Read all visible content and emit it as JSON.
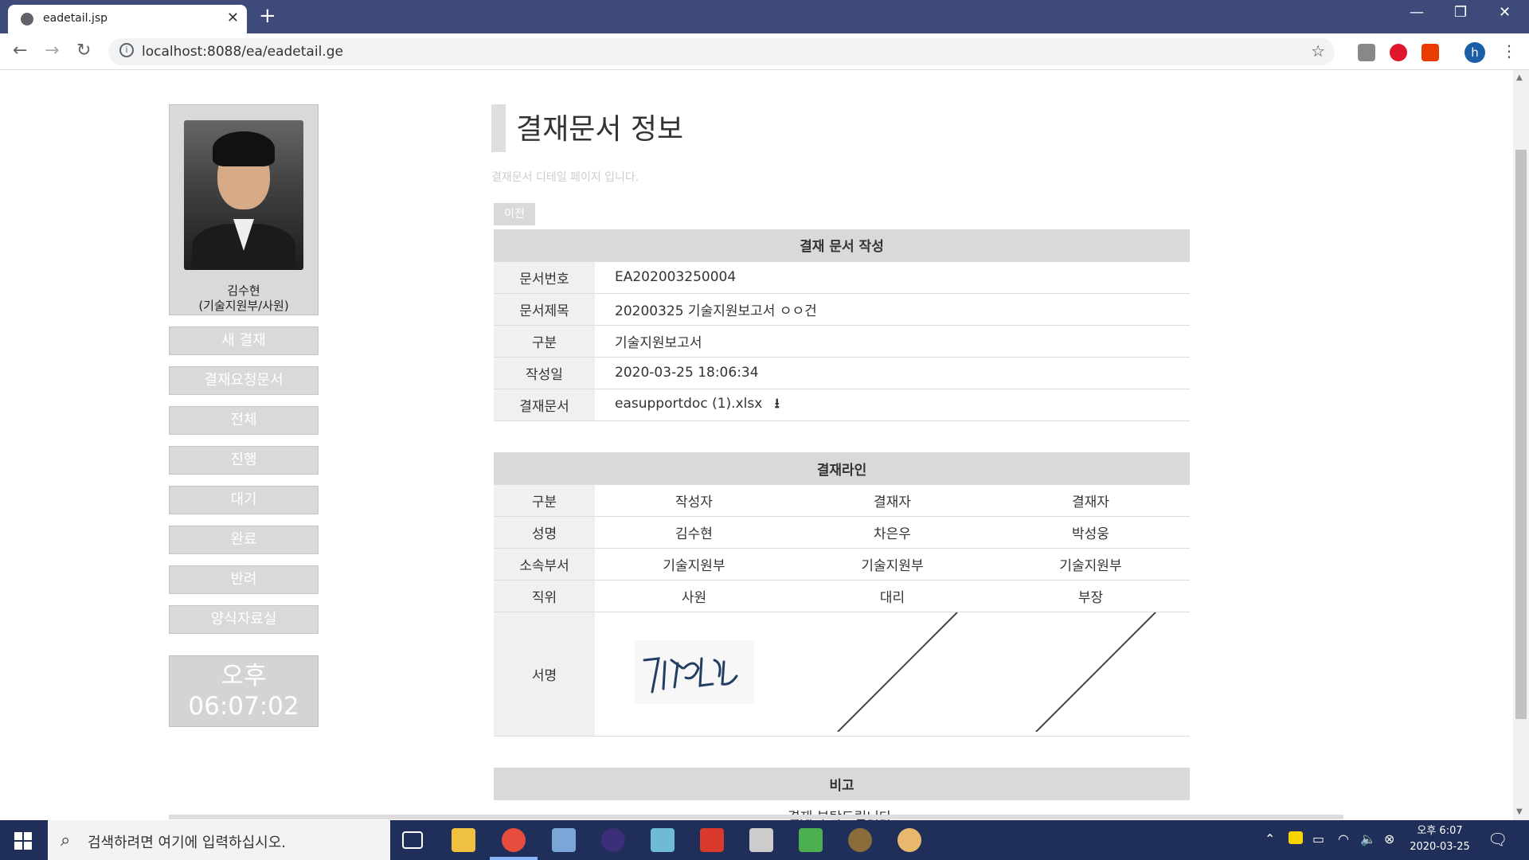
{
  "browser": {
    "tab_title": "eadetail.jsp",
    "url": "localhost:8088/ea/eadetail.ge",
    "avatar_letter": "h"
  },
  "sidebar": {
    "user_name": "김수현",
    "user_dept": "(기술지원부/사원)",
    "menu": [
      "새 결재",
      "결재요청문서",
      "전체",
      "진행",
      "대기",
      "완료",
      "반려",
      "양식자료실"
    ],
    "clock_ampm": "오후",
    "clock_time": "06:07:02"
  },
  "main": {
    "title": "결재문서 정보",
    "subtitle": "결재문서 디테일 페이지 입니다.",
    "prev_label": "이전",
    "section_doc": "결재 문서 작성",
    "doc_fields": [
      {
        "label": "문서번호",
        "value": "EA202003250004"
      },
      {
        "label": "문서제목",
        "value": "20200325 기술지원보고서 ㅇㅇ건"
      },
      {
        "label": "구분",
        "value": "기술지원보고서"
      },
      {
        "label": "작성일",
        "value": "2020-03-25 18:06:34"
      },
      {
        "label": "결재문서",
        "value": "easupportdoc (1).xlsx"
      }
    ],
    "section_line": "결재라인",
    "line_rows": [
      {
        "label": "구분",
        "cells": [
          "작성자",
          "결재자",
          "결재자"
        ]
      },
      {
        "label": "성명",
        "cells": [
          "김수현",
          "차은우",
          "박성웅"
        ]
      },
      {
        "label": "소속부서",
        "cells": [
          "기술지원부",
          "기술지원부",
          "기술지원부"
        ]
      },
      {
        "label": "직위",
        "cells": [
          "사원",
          "대리",
          "부장"
        ]
      }
    ],
    "signature_label": "서명",
    "section_note": "비고",
    "note_text": "결재 부탁드립니다."
  },
  "taskbar": {
    "search_placeholder": "검색하려면 여기에 입력하십시오.",
    "time_ampm_time": "오후 6:07",
    "date": "2020-03-25"
  }
}
